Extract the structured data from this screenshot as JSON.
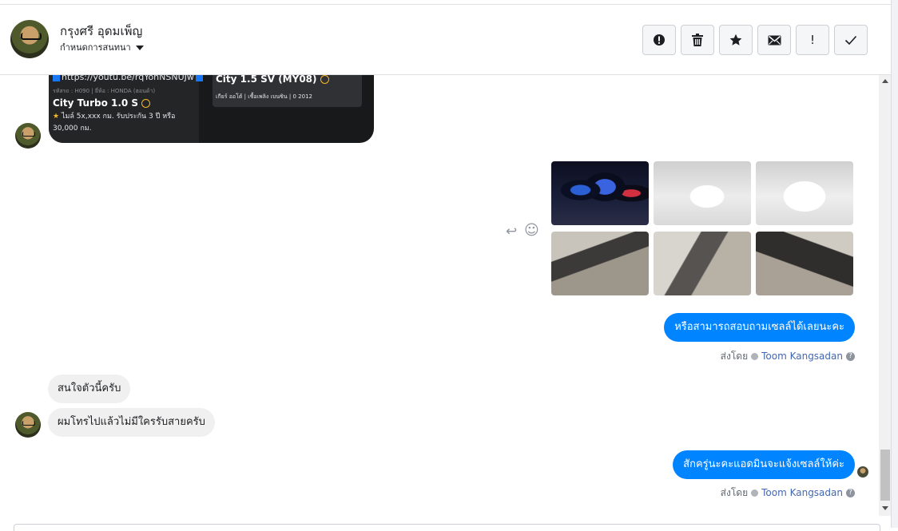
{
  "header": {
    "contact_name": "กรุงศรี อุดมเพ็ญ",
    "assign_label": "กำหนดการสนทนา",
    "toolbar": [
      {
        "name": "spam-button",
        "icon": "alert-circle-icon"
      },
      {
        "name": "delete-button",
        "icon": "trash-icon"
      },
      {
        "name": "star-button",
        "icon": "star-icon"
      },
      {
        "name": "mark-unread-button",
        "icon": "envelope-icon"
      },
      {
        "name": "follow-up-button",
        "icon": "exclamation-icon",
        "glyph": "!"
      },
      {
        "name": "mark-done-button",
        "icon": "check-icon"
      }
    ]
  },
  "card": {
    "link": "https://youtu.be/rqYohNSNUJw",
    "meta": "รหัสรถ : H090 | ยี่ห้อ : HONDA (ฮอนด้า)",
    "title": "City Turbo 1.0 S",
    "desc": "ไมล์ 5x,xxx กม. รับประกัน 3 ปี หรือ 30,000 กม.",
    "star": "★",
    "right_title": "City 1.5 SV (MY08)",
    "right_meta": "เกียร์ ออโต้  |  เชื้อเพลิง เบนซิน  |  0 2012"
  },
  "messages": {
    "out1": "หรือสามารถสอบถามเซลล์ได้เลยนะคะ",
    "sent_label": "ส่งโดย",
    "sender": "Toom Kangsadan",
    "help": "?",
    "in1": "สนใจตัวนี้ครับ",
    "in2": "ผมโทรไปแล้วไม่มีใครรับสายครับ",
    "out2": "สักครู่นะคะแอดมินจะแจ้งเซลล์ให้ค่ะ"
  },
  "reactions": {
    "reply": "↩",
    "emoji": "☺"
  }
}
